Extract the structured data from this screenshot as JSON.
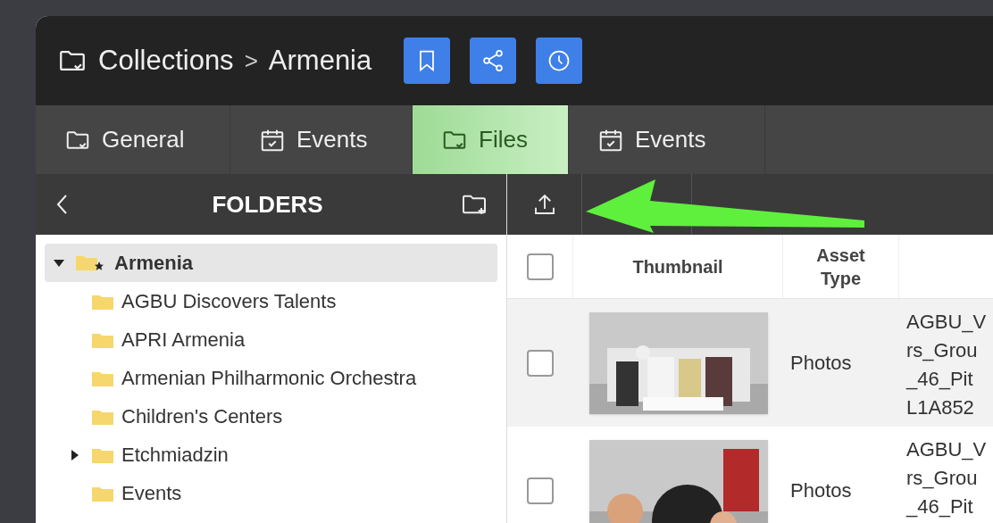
{
  "breadcrumb": [
    "Collections",
    "Armenia"
  ],
  "separator": ">",
  "tabs": [
    {
      "label": "General",
      "kind": "folder",
      "selected": false
    },
    {
      "label": "Events",
      "kind": "calendar",
      "selected": false
    },
    {
      "label": "Files",
      "kind": "folder",
      "selected": true
    },
    {
      "label": "Events",
      "kind": "calendar",
      "selected": false
    }
  ],
  "folders_panel": {
    "title": "FOLDERS",
    "tree": [
      {
        "label": "Armenia",
        "selected": true,
        "expanded": true,
        "children": [
          {
            "label": "AGBU Discovers Talents",
            "selected": false
          },
          {
            "label": "APRI Armenia",
            "selected": false
          },
          {
            "label": "Armenian Philharmonic Orchestra",
            "selected": false
          },
          {
            "label": "Children's Centers",
            "selected": false
          },
          {
            "label": "Etchmiadzin",
            "selected": false,
            "expanded": false
          },
          {
            "label": "Events",
            "selected": false
          }
        ]
      }
    ]
  },
  "table": {
    "all_checked": false,
    "columns": [
      "Thumbnail",
      "Asset Type"
    ],
    "rows": [
      {
        "checked": false,
        "selected": true,
        "asset_type": "Photos",
        "file_name": [
          "AGBU_V",
          "rs_Grou",
          "_46_Pit",
          "L1A852"
        ]
      },
      {
        "checked": false,
        "selected": false,
        "asset_type": "Photos",
        "file_name": [
          "AGBU_V",
          "rs_Grou",
          "_46_Pit"
        ]
      }
    ]
  }
}
